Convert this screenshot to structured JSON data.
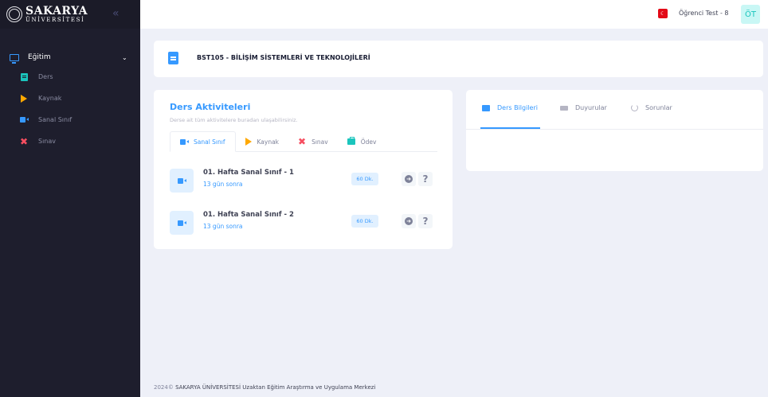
{
  "brand": {
    "name": "SAKARYA",
    "sub": "ÜNİVERSİTESİ"
  },
  "sidebar": {
    "section": {
      "label": "Eğitim",
      "icon": "monitor-icon"
    },
    "items": [
      {
        "label": "Ders",
        "icon": "book-icon",
        "color": "#1bc5bd"
      },
      {
        "label": "Kaynak",
        "icon": "play-icon",
        "color": "#ffa800"
      },
      {
        "label": "Sanal Sınıf",
        "icon": "video-camera-icon",
        "color": "#3699ff"
      },
      {
        "label": "Sınav",
        "icon": "x-icon",
        "color": "#f64e60"
      }
    ]
  },
  "header": {
    "user": "Öğrenci Test - 8",
    "initials": "ÖT",
    "language_flag": "tr-flag-icon"
  },
  "course": {
    "title": "BST105 - BİLİŞİM SİSTEMLERİ VE TEKNOLOJİLERİ"
  },
  "activities": {
    "title": "Ders Aktiviteleri",
    "subtitle": "Derse ait tüm aktivitelere buradan ulaşabilirsiniz.",
    "tabs": [
      {
        "label": "Sanal Sınıf",
        "active": true
      },
      {
        "label": "Kaynak",
        "active": false
      },
      {
        "label": "Sınav",
        "active": false
      },
      {
        "label": "Ödev",
        "active": false
      }
    ],
    "rows": [
      {
        "title": "01. Hafta Sanal Sınıf - 1",
        "time": "13 gün sonra",
        "duration": "60 Dk."
      },
      {
        "title": "01. Hafta Sanal Sınıf - 2",
        "time": "13 gün sonra",
        "duration": "60 Dk."
      }
    ]
  },
  "info_tabs": [
    {
      "label": "Ders Bilgileri",
      "active": true
    },
    {
      "label": "Duyurular",
      "active": false
    },
    {
      "label": "Sorunlar",
      "active": false
    }
  ],
  "footer": {
    "year": "2024©",
    "text": "SAKARYA ÜNİVERSİTESİ Uzaktan Eğitim Araştırma ve Uygulama Merkezi"
  },
  "colors": {
    "primary": "#3699ff",
    "sidebar_bg": "#1e1e2d",
    "page_bg": "#eef0f8"
  }
}
